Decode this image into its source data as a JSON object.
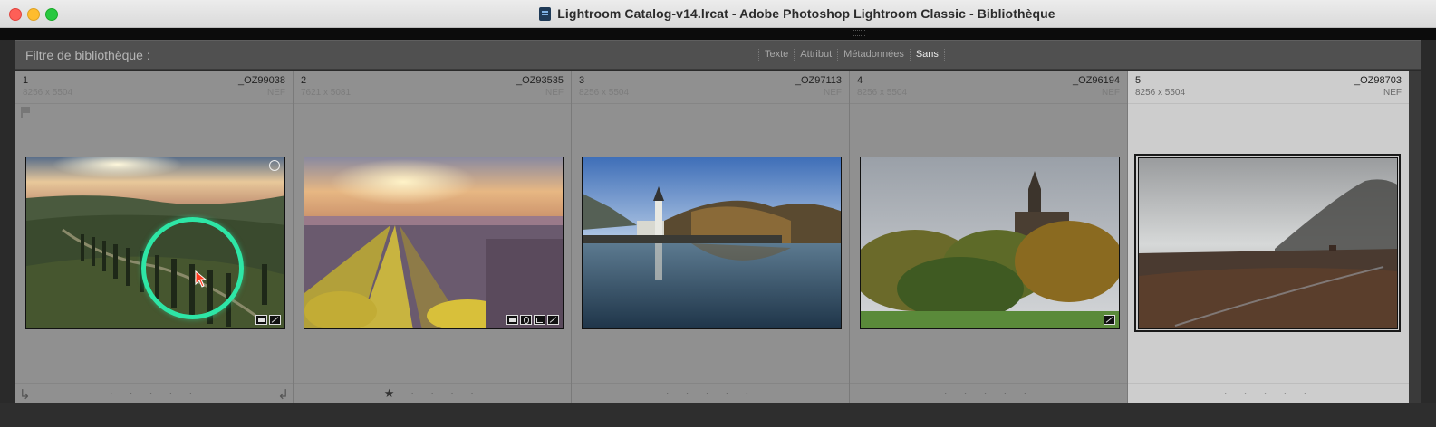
{
  "window": {
    "title": "Lightroom Catalog-v14.lrcat - Adobe Photoshop Lightroom Classic - Bibliothèque"
  },
  "filter_bar": {
    "title": "Filtre de bibliothèque :",
    "tabs": [
      {
        "label": "Texte",
        "active": false
      },
      {
        "label": "Attribut",
        "active": false
      },
      {
        "label": "Métadonnées",
        "active": false
      },
      {
        "label": "Sans",
        "active": true
      }
    ]
  },
  "photos": [
    {
      "index": "1",
      "filename": "_OZ99038",
      "dimensions": "8256 x 5504",
      "type": "NEF",
      "rating": "· · · · ·",
      "scene": "tuscany-sunset"
    },
    {
      "index": "2",
      "filename": "_OZ93535",
      "dimensions": "7621 x 5081",
      "type": "NEF",
      "rating": "★ · · · ·",
      "scene": "lavender-field"
    },
    {
      "index": "3",
      "filename": "_OZ97113",
      "dimensions": "8256 x 5504",
      "type": "NEF",
      "rating": "· · · · ·",
      "scene": "lake-church"
    },
    {
      "index": "4",
      "filename": "_OZ96194",
      "dimensions": "8256 x 5504",
      "type": "NEF",
      "rating": "· · · · ·",
      "scene": "autumn-castle"
    },
    {
      "index": "5",
      "filename": "_OZ98703",
      "dimensions": "8256 x 5504",
      "type": "NEF",
      "rating": "· · · · ·",
      "scene": "misty-moor"
    }
  ],
  "colors": {
    "cursor_highlight": "#2ee6a6",
    "cell_bg": "#909090",
    "cell_selected_bg": "#cdcdcd"
  }
}
